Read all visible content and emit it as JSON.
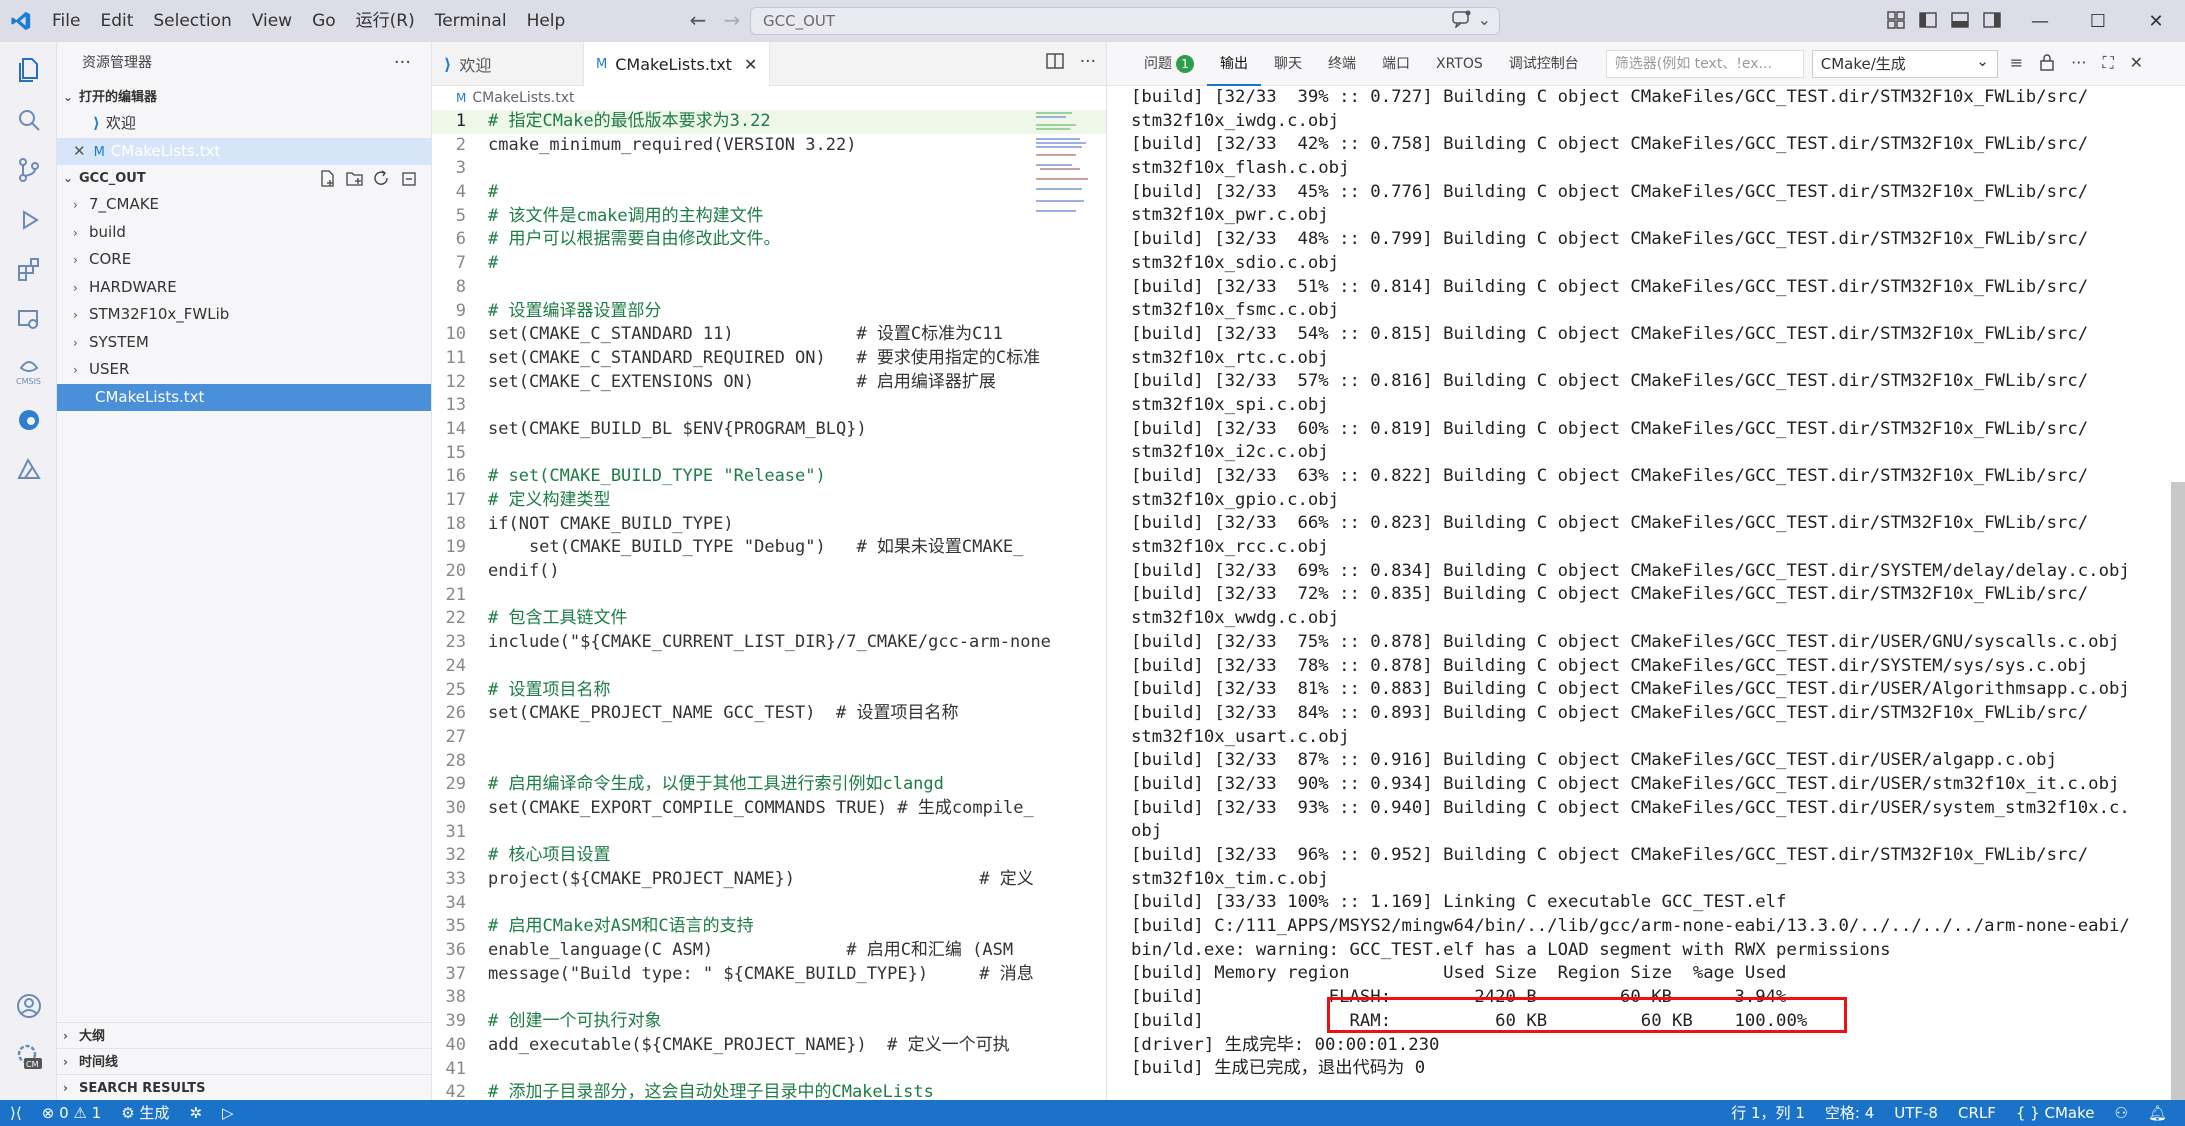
{
  "menu": [
    "File",
    "Edit",
    "Selection",
    "View",
    "Go",
    "运行(R)",
    "Terminal",
    "Help"
  ],
  "search": {
    "value": "GCC_OUT"
  },
  "sidebar": {
    "title": "资源管理器",
    "open_editors_title": "打开的编辑器",
    "open_editors": [
      {
        "label": "欢迎"
      },
      {
        "label": "CMakeLists.txt"
      }
    ],
    "folder_title": "GCC_OUT",
    "tree": [
      "7_CMAKE",
      "build",
      "CORE",
      "HARDWARE",
      "STM32F10x_FWLib",
      "SYSTEM",
      "USER",
      "CMakeLists.txt"
    ],
    "bottom_sections": [
      "大纲",
      "时间线",
      "SEARCH RESULTS"
    ]
  },
  "editor": {
    "tabs": [
      {
        "label": "欢迎"
      },
      {
        "label": "CMakeLists.txt"
      }
    ],
    "breadcrumb": "CMakeLists.txt",
    "lines": [
      "# 指定CMake的最低版本要求为3.22",
      "cmake_minimum_required(VERSION 3.22)",
      "",
      "#",
      "# 该文件是cmake调用的主构建文件",
      "# 用户可以根据需要自由修改此文件。",
      "#",
      "",
      "# 设置编译器设置部分",
      "set(CMAKE_C_STANDARD 11)            # 设置C标准为C11",
      "set(CMAKE_C_STANDARD_REQUIRED ON)   # 要求使用指定的C标准",
      "set(CMAKE_C_EXTENSIONS ON)          # 启用编译器扩展",
      "",
      "set(CMAKE_BUILD_BL $ENV{PROGRAM_BLQ})",
      "",
      "# set(CMAKE_BUILD_TYPE \"Release\")",
      "# 定义构建类型",
      "if(NOT CMAKE_BUILD_TYPE)",
      "    set(CMAKE_BUILD_TYPE \"Debug\")   # 如果未设置CMAKE_",
      "endif()",
      "",
      "# 包含工具链文件",
      "include(\"${CMAKE_CURRENT_LIST_DIR}/7_CMAKE/gcc-arm-none",
      "",
      "# 设置项目名称",
      "set(CMAKE_PROJECT_NAME GCC_TEST)  # 设置项目名称",
      "",
      "",
      "# 启用编译命令生成，以便于其他工具进行索引例如clangd",
      "set(CMAKE_EXPORT_COMPILE_COMMANDS TRUE) # 生成compile_",
      "",
      "# 核心项目设置",
      "project(${CMAKE_PROJECT_NAME})                  # 定义",
      "",
      "# 启用CMake对ASM和C语言的支持",
      "enable_language(C ASM)             # 启用C和汇编 (ASM",
      "message(\"Build type: \" ${CMAKE_BUILD_TYPE})     # 消息",
      "",
      "# 创建一个可执行对象",
      "add_executable(${CMAKE_PROJECT_NAME})  # 定义一个可执",
      "",
      "# 添加子目录部分，这会自动处理子目录中的CMakeLists"
    ]
  },
  "output": {
    "tabs": [
      "问题",
      "输出",
      "聊天",
      "终端",
      "端口",
      "XRTOS",
      "调试控制台"
    ],
    "problems_count": "1",
    "filter_placeholder": "筛选器(例如 text、!ex...",
    "channel": "CMake/生成",
    "lines": [
      "[build] [32/33  39% :: 0.727] Building C object CMakeFiles/GCC_TEST.dir/STM32F10x_FWLib/src/",
      "stm32f10x_iwdg.c.obj",
      "[build] [32/33  42% :: 0.758] Building C object CMakeFiles/GCC_TEST.dir/STM32F10x_FWLib/src/",
      "stm32f10x_flash.c.obj",
      "[build] [32/33  45% :: 0.776] Building C object CMakeFiles/GCC_TEST.dir/STM32F10x_FWLib/src/",
      "stm32f10x_pwr.c.obj",
      "[build] [32/33  48% :: 0.799] Building C object CMakeFiles/GCC_TEST.dir/STM32F10x_FWLib/src/",
      "stm32f10x_sdio.c.obj",
      "[build] [32/33  51% :: 0.814] Building C object CMakeFiles/GCC_TEST.dir/STM32F10x_FWLib/src/",
      "stm32f10x_fsmc.c.obj",
      "[build] [32/33  54% :: 0.815] Building C object CMakeFiles/GCC_TEST.dir/STM32F10x_FWLib/src/",
      "stm32f10x_rtc.c.obj",
      "[build] [32/33  57% :: 0.816] Building C object CMakeFiles/GCC_TEST.dir/STM32F10x_FWLib/src/",
      "stm32f10x_spi.c.obj",
      "[build] [32/33  60% :: 0.819] Building C object CMakeFiles/GCC_TEST.dir/STM32F10x_FWLib/src/",
      "stm32f10x_i2c.c.obj",
      "[build] [32/33  63% :: 0.822] Building C object CMakeFiles/GCC_TEST.dir/STM32F10x_FWLib/src/",
      "stm32f10x_gpio.c.obj",
      "[build] [32/33  66% :: 0.823] Building C object CMakeFiles/GCC_TEST.dir/STM32F10x_FWLib/src/",
      "stm32f10x_rcc.c.obj",
      "[build] [32/33  69% :: 0.834] Building C object CMakeFiles/GCC_TEST.dir/SYSTEM/delay/delay.c.obj",
      "[build] [32/33  72% :: 0.835] Building C object CMakeFiles/GCC_TEST.dir/STM32F10x_FWLib/src/",
      "stm32f10x_wwdg.c.obj",
      "[build] [32/33  75% :: 0.878] Building C object CMakeFiles/GCC_TEST.dir/USER/GNU/syscalls.c.obj",
      "[build] [32/33  78% :: 0.878] Building C object CMakeFiles/GCC_TEST.dir/SYSTEM/sys/sys.c.obj",
      "[build] [32/33  81% :: 0.883] Building C object CMakeFiles/GCC_TEST.dir/USER/Algorithmsapp.c.obj",
      "[build] [32/33  84% :: 0.893] Building C object CMakeFiles/GCC_TEST.dir/STM32F10x_FWLib/src/",
      "stm32f10x_usart.c.obj",
      "[build] [32/33  87% :: 0.916] Building C object CMakeFiles/GCC_TEST.dir/USER/algapp.c.obj",
      "[build] [32/33  90% :: 0.934] Building C object CMakeFiles/GCC_TEST.dir/USER/stm32f10x_it.c.obj",
      "[build] [32/33  93% :: 0.940] Building C object CMakeFiles/GCC_TEST.dir/USER/system_stm32f10x.c.",
      "obj",
      "[build] [32/33  96% :: 0.952] Building C object CMakeFiles/GCC_TEST.dir/STM32F10x_FWLib/src/",
      "stm32f10x_tim.c.obj",
      "[build] [33/33 100% :: 1.169] Linking C executable GCC_TEST.elf",
      "[build] C:/111_APPS/MSYS2/mingw64/bin/../lib/gcc/arm-none-eabi/13.3.0/../../../../arm-none-eabi/",
      "bin/ld.exe: warning: GCC_TEST.elf has a LOAD segment with RWX permissions",
      "[build] Memory region         Used Size  Region Size  %age Used",
      "[build]            FLASH:        2420 B        60 KB      3.94%",
      "[build]              RAM:          60 KB         60 KB    100.00%",
      "[driver] 生成完毕: 00:00:01.230",
      "[build] 生成已完成，退出代码为 0"
    ]
  },
  "statusbar": {
    "errors": "0",
    "warnings": "1",
    "build_label": "生成",
    "position": "行 1，列 1",
    "spaces": "空格: 4",
    "encoding": "UTF-8",
    "eol": "CRLF",
    "language": "CMake"
  }
}
